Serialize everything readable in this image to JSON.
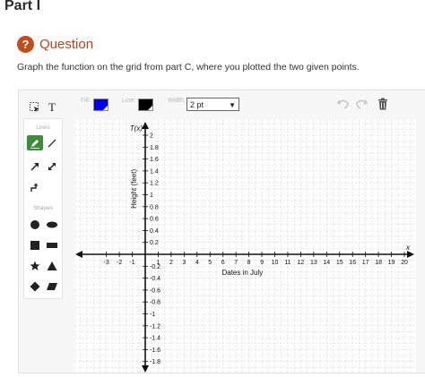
{
  "part_title": "Part I",
  "question": {
    "icon": "question-icon",
    "label": "Question"
  },
  "instruction": "Graph the function on the grid from part C, where you plotted the two given points.",
  "toolbar": {
    "fill_label": "Fill:",
    "fill_color": "#0000ee",
    "line_label": "Line:",
    "line_color": "#000000",
    "width_label": "Width:",
    "width_value": "2 pt",
    "undo_icon": "undo-icon",
    "redo_icon": "redo-icon",
    "delete_icon": "trash-icon"
  },
  "sidebar": {
    "lines_title": "Lines",
    "shapes_title": "Shapes",
    "tools": [
      "select-tool",
      "text-tool",
      "pencil-tool",
      "line-tool",
      "arrow-tool",
      "double-arrow-tool",
      "connector-tool",
      "circle-tool",
      "ellipse-tool",
      "square-tool",
      "rectangle-tool",
      "star-tool",
      "triangle-tool",
      "diamond-tool",
      "parallelogram-tool"
    ]
  },
  "graph": {
    "x_axis_var": "x",
    "y_axis_var": "T(x)",
    "x_label": "Dates in July",
    "y_label": "Height (feet)",
    "x_ticks": [
      "-3",
      "-2",
      "-1",
      "1",
      "2",
      "3",
      "4",
      "5",
      "6",
      "7",
      "8",
      "9",
      "10",
      "11",
      "12",
      "13",
      "14",
      "15",
      "16",
      "17",
      "18",
      "19",
      "20"
    ],
    "y_ticks_pos": [
      "2",
      "1.8",
      "1.6",
      "1.4",
      "1.2",
      "1",
      "0.8",
      "0.6",
      "0.4",
      "0.2"
    ],
    "y_ticks_neg": [
      "-0.2",
      "-0.4",
      "-0.6",
      "-0.8",
      "-1",
      "-1.2",
      "-1.4",
      "-1.6",
      "-1.8"
    ]
  }
}
